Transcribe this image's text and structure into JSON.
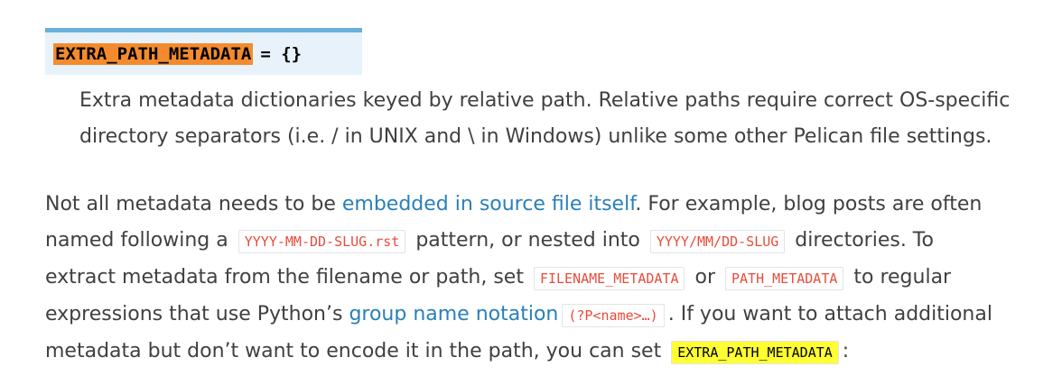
{
  "setting": {
    "name": "EXTRA_PATH_METADATA",
    "rest": "= {}",
    "desc_line1": "Extra metadata dictionaries keyed by relative path. Relative paths require correct OS-specific",
    "desc_line2": "directory separators (i.e. / in UNIX and \\ in Windows) unlike some other Pelican file settings."
  },
  "para": {
    "l1_a": "Not all metadata needs to be ",
    "l1_link": "embedded in source file itself",
    "l1_b": ". For example, blog posts are often",
    "l2_a": "named following a ",
    "l2_code1": "YYYY-MM-DD-SLUG.rst",
    "l2_b": " pattern, or nested into ",
    "l2_code2": "YYYY/MM/DD-SLUG",
    "l2_c": " directories. To",
    "l3_a": "extract metadata from the filename or path, set ",
    "l3_code1": "FILENAME_METADATA",
    "l3_b": " or ",
    "l3_code2": "PATH_METADATA",
    "l3_c": " to regular",
    "l4_a": "expressions that use Python’s ",
    "l4_link": "group name notation",
    "l4_code": "(?P<name>…)",
    "l4_b": ". If you want to attach additional",
    "l5_a": "metadata but don’t want to encode it in the path, you can set ",
    "l5_code": "EXTRA_PATH_METADATA",
    "l5_b": ":"
  },
  "colors": {
    "link": "#2980b9",
    "code_literal": "#e74c3c",
    "sig_background": "#e7f2fa",
    "sig_border": "#6ab0de",
    "name_highlight": "#f38b2e",
    "search_highlight": "#ffff33"
  }
}
